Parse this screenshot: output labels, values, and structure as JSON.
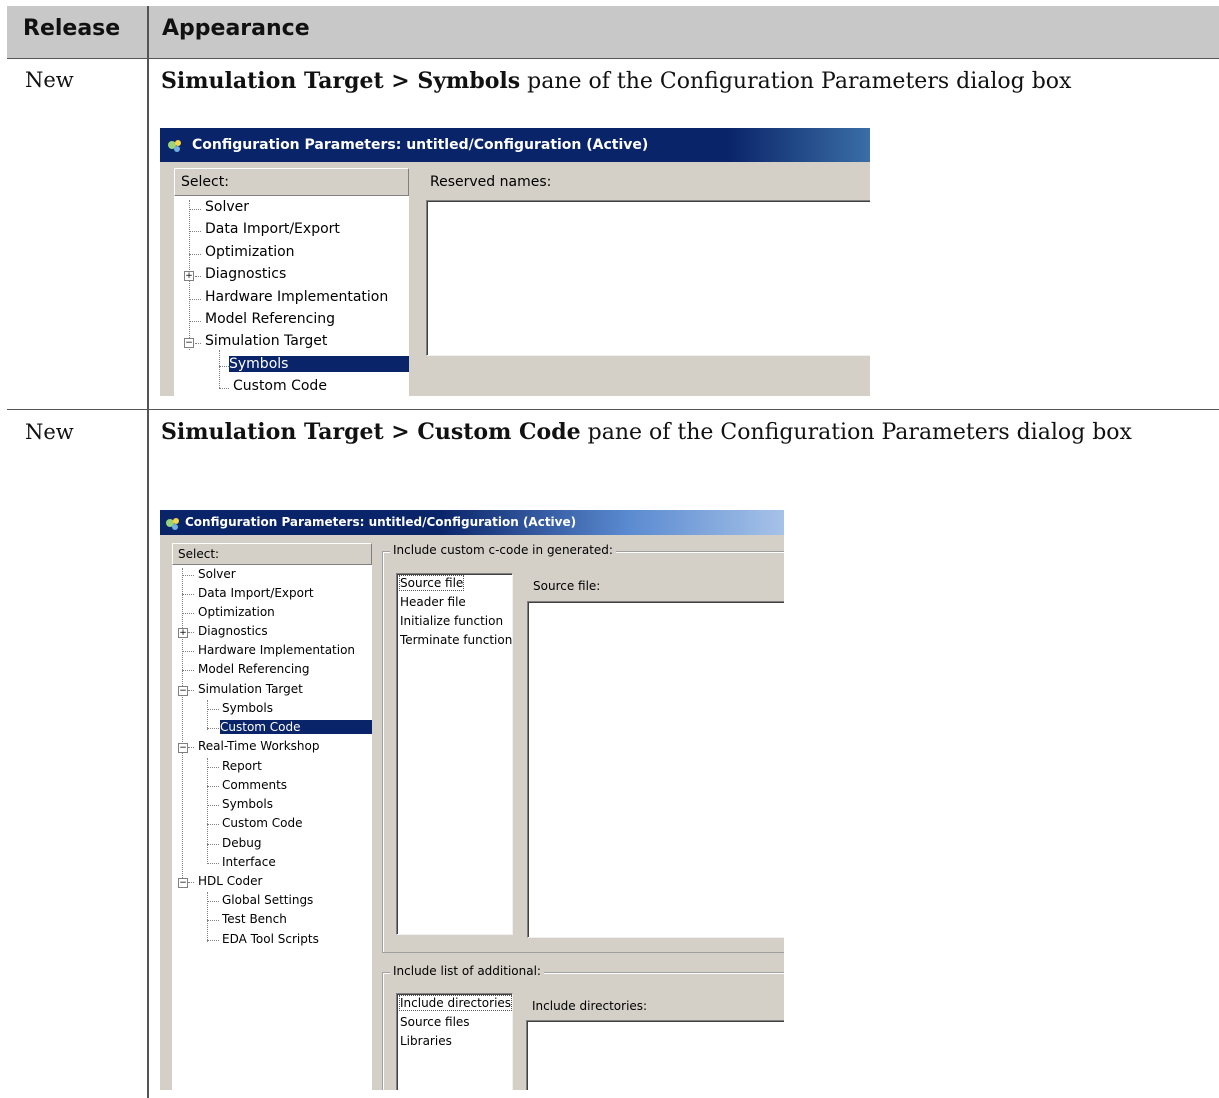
{
  "table": {
    "header": {
      "release": "Release",
      "appearance": "Appearance"
    },
    "rows": [
      {
        "release": "New",
        "description_bold": "Simulation Target > Symbols",
        "description_rest": " pane of the Configuration Parameters dialog box",
        "dialog": {
          "title": "Configuration Parameters: untitled/Configuration (Active)",
          "select_label": "Select:",
          "tree": [
            "Solver",
            "Data Import/Export",
            "Optimization",
            "Diagnostics",
            "Hardware Implementation",
            "Model Referencing",
            "Simulation Target",
            "Symbols",
            "Custom Code"
          ],
          "selected_item": "Symbols",
          "reserved_names_label": "Reserved names:"
        }
      },
      {
        "release": "New",
        "description_bold": "Simulation Target > Custom Code",
        "description_rest": " pane of the Configuration Parameters dialog box",
        "dialog": {
          "title": "Configuration Parameters: untitled/Configuration (Active)",
          "select_label": "Select:",
          "tree": [
            "Solver",
            "Data Import/Export",
            "Optimization",
            "Diagnostics",
            "Hardware Implementation",
            "Model Referencing",
            "Simulation Target",
            "Symbols",
            "Custom Code",
            "Real-Time Workshop",
            "Report",
            "Comments",
            "Symbols",
            "Custom Code",
            "Debug",
            "Interface",
            "HDL Coder",
            "Global Settings",
            "Test Bench",
            "EDA Tool Scripts"
          ],
          "selected_item": "Custom Code",
          "group1_label": "Include custom c-code in generated:",
          "group1_list": [
            "Source file",
            "Header file",
            "Initialize function",
            "Terminate function"
          ],
          "group1_field_label": "Source file:",
          "group2_label": "Include list of additional:",
          "group2_list": [
            "Include directories",
            "Source files",
            "Libraries"
          ],
          "group2_field_label": "Include directories:"
        }
      }
    ]
  },
  "colors": {
    "header_bg": "#c8c8c8",
    "title_bar": "#0a246a",
    "selection": "#0a246a",
    "dialog_bg": "#d4d0c8"
  },
  "icons": [
    "simulink-config-icon",
    "tree-expander-plus-icon",
    "tree-expander-minus-icon"
  ]
}
